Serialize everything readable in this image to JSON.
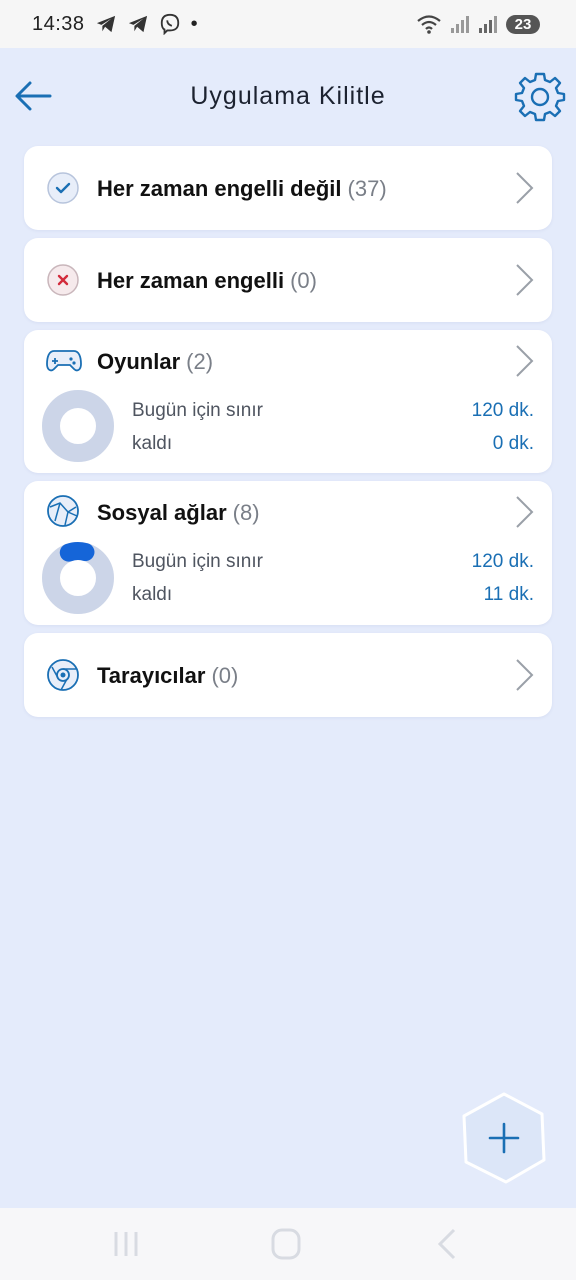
{
  "status": {
    "time": "14:38",
    "battery": "23"
  },
  "header": {
    "title": "Uygulama Kilitle",
    "back_icon": "arrow-left-icon",
    "settings_icon": "gear-icon"
  },
  "categories": [
    {
      "label": "Her zaman engelli değil",
      "count": "(37)",
      "icon": "check-circle-icon"
    },
    {
      "label": "Her zaman engelli",
      "count": "(0)",
      "icon": "x-circle-icon"
    },
    {
      "label": "Oyunlar",
      "count": "(2)",
      "icon": "gamepad-icon",
      "limit_label": "Bugün için sınır",
      "limit_value": "120 dk.",
      "remaining_label": "kaldı",
      "remaining_value": "0 dk.",
      "used_fraction": 0
    },
    {
      "label": "Sosyal ağlar",
      "count": "(8)",
      "icon": "globe-icon",
      "limit_label": "Bugün için sınır",
      "limit_value": "120 dk.",
      "remaining_label": "kaldı",
      "remaining_value": "11 dk.",
      "used_fraction": 0.1
    },
    {
      "label": "Tarayıcılar",
      "count": "(0)",
      "icon": "browser-icon"
    }
  ],
  "colors": {
    "accent": "#1a6fb4",
    "background": "#e4ebfb",
    "donut_track": "#ccd5e8",
    "donut_fill": "#1565d8"
  }
}
